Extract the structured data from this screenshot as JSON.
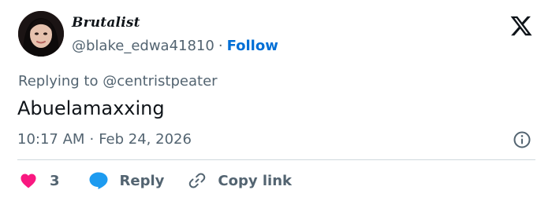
{
  "tweet": {
    "author": {
      "display_name": "Brutalist",
      "handle": "@blake_edwa41810",
      "follow_label": "Follow"
    },
    "reply_context": {
      "prefix": "Replying to",
      "mention": "@centristpeater"
    },
    "text": "Abuelamaxxing",
    "timestamp": {
      "time": "10:17 AM",
      "date": "Feb 24, 2026"
    },
    "actions": {
      "like_count": "3",
      "reply_label": "Reply",
      "copy_link_label": "Copy link"
    }
  },
  "icons": {
    "logo": "x-logo-icon",
    "info": "info-icon",
    "like": "heart-icon",
    "reply": "speech-bubble-icon",
    "copy": "link-icon"
  },
  "colors": {
    "heart": "#f91880",
    "reply_bubble": "#1d9bf0",
    "follow": "#006fd6",
    "secondary_text": "#536471",
    "divider": "#cfd9de"
  }
}
